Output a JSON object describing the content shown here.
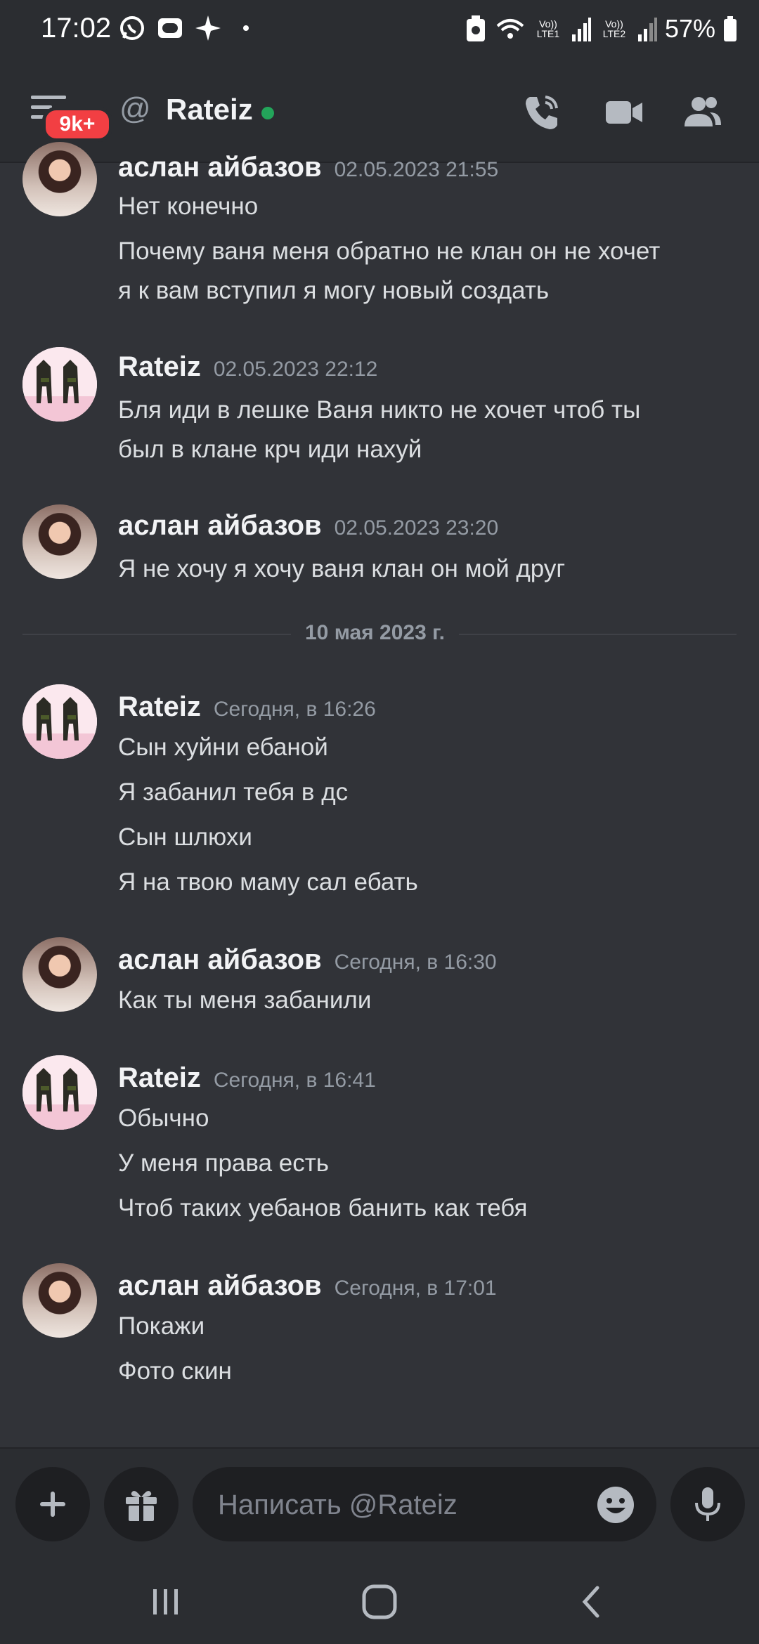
{
  "status_bar": {
    "time": "17:02",
    "sim1": "Vo)) LTE1",
    "sim2": "Vo)) LTE2",
    "battery": "57%"
  },
  "header": {
    "badge": "9k+",
    "title": "Rateiz",
    "online_color": "#23a55a"
  },
  "messages": [
    {
      "author": "аслан айбазов",
      "time": "02.05.2023 21:55",
      "lines": [
        "Нет конечно",
        "Почему ваня  меня обратно не клан он не хочет",
        "я к вам вступил  я могу  новый создать"
      ]
    },
    {
      "author": "Rateiz",
      "time": "02.05.2023 22:12",
      "lines": [
        "Бля иди в лешке Ваня никто не хочет чтоб ты",
        "был в клане крч иди нахуй"
      ]
    },
    {
      "author": "аслан айбазов",
      "time": "02.05.2023 23:20",
      "lines": [
        "Я не хочу  я хочу ваня клан он мой друг"
      ]
    },
    {
      "author": "Rateiz",
      "time": "Сегодня, в 16:26",
      "lines": [
        "Сын хуйни ебаной",
        "Я забанил тебя в дс",
        "Сын шлюхи",
        "Я на твою маму сал ебать"
      ]
    },
    {
      "author": "аслан айбазов",
      "time": "Сегодня, в 16:30",
      "lines": [
        "Как ты меня забанили"
      ]
    },
    {
      "author": "Rateiz",
      "time": "Сегодня, в 16:41",
      "lines": [
        "Обычно",
        "У меня права есть",
        "Чтоб таких уебанов банить как тебя"
      ]
    },
    {
      "author": "аслан айбазов",
      "time": "Сегодня, в 17:01",
      "lines": [
        "Покажи",
        "Фото скин"
      ]
    }
  ],
  "divider": "10 мая 2023 г.",
  "composer": {
    "placeholder": "Написать @Rateiz"
  },
  "icons": [
    "menu-icon",
    "at-icon",
    "phone-icon",
    "video-icon",
    "members-icon",
    "plus-icon",
    "gift-icon",
    "emoji-icon",
    "microphone-icon",
    "recents-icon",
    "home-icon",
    "back-icon"
  ],
  "colors": {
    "background": "#313338",
    "header": "#2b2d31",
    "badge": "#f23f43"
  }
}
